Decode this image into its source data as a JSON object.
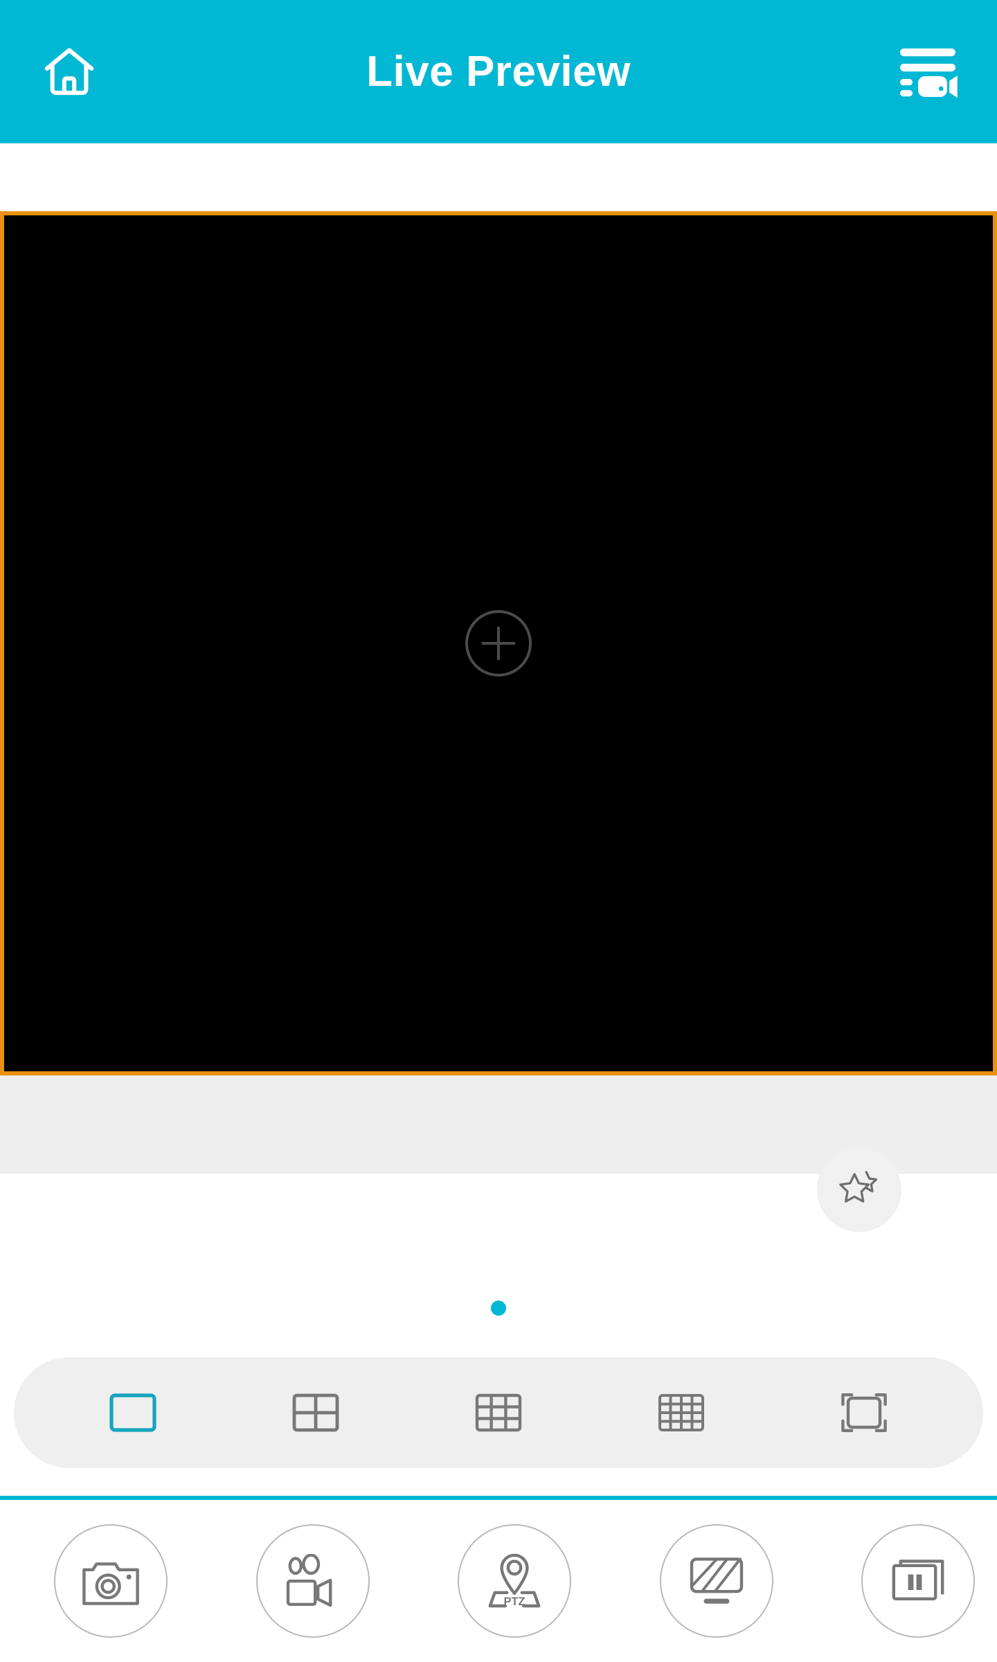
{
  "app": {
    "title": "Live Preview",
    "accent_color": "#00b8d4",
    "selected_border_color": "#e8920f",
    "panel_gray": "#eeeeee",
    "icon_gray": "#787878"
  },
  "header": {
    "title": "Live Preview",
    "left_icon": "home-icon",
    "left_icon_label": "Home",
    "right_icon": "camera-list-icon",
    "right_icon_label": "Camera List"
  },
  "video": {
    "cells": [
      {
        "state": "empty",
        "placeholder_icon": "plus-circle-icon",
        "placeholder_label": "Add Camera",
        "selected": true
      }
    ],
    "layout": "1x1",
    "background": "#000000"
  },
  "favorites": {
    "icon": "double-star-icon",
    "label": "Favorites"
  },
  "pagination": {
    "total_pages": 1,
    "current_page": 1,
    "dots": [
      {
        "active": true
      }
    ]
  },
  "layout_selector": {
    "selected_index": 0,
    "options": [
      {
        "id": "layout-1x1",
        "label": "1x1",
        "icon": "single-pane-icon",
        "cols": 1,
        "rows": 1,
        "selected": true
      },
      {
        "id": "layout-2x2",
        "label": "2x2",
        "icon": "grid-4-icon",
        "cols": 2,
        "rows": 2,
        "selected": false
      },
      {
        "id": "layout-3x3",
        "label": "3x3",
        "icon": "grid-9-icon",
        "cols": 3,
        "rows": 3,
        "selected": false
      },
      {
        "id": "layout-4x4",
        "label": "4x4",
        "icon": "grid-16-icon",
        "cols": 4,
        "rows": 4,
        "selected": false
      },
      {
        "id": "layout-fullscreen",
        "label": "Fullscreen",
        "icon": "fullscreen-icon",
        "cols": 1,
        "rows": 1,
        "selected": false
      }
    ]
  },
  "toolbar": {
    "buttons": [
      {
        "id": "snapshot",
        "label": "Snapshot",
        "icon": "camera-icon"
      },
      {
        "id": "record",
        "label": "Record",
        "icon": "video-camera-icon"
      },
      {
        "id": "ptz",
        "label": "PTZ",
        "icon": "ptz-icon",
        "text": "PTZ"
      },
      {
        "id": "stream-quality",
        "label": "Stream Quality",
        "icon": "monitor-stripes-icon"
      },
      {
        "id": "pause-all",
        "label": "Pause All",
        "icon": "pause-windows-icon"
      }
    ]
  }
}
